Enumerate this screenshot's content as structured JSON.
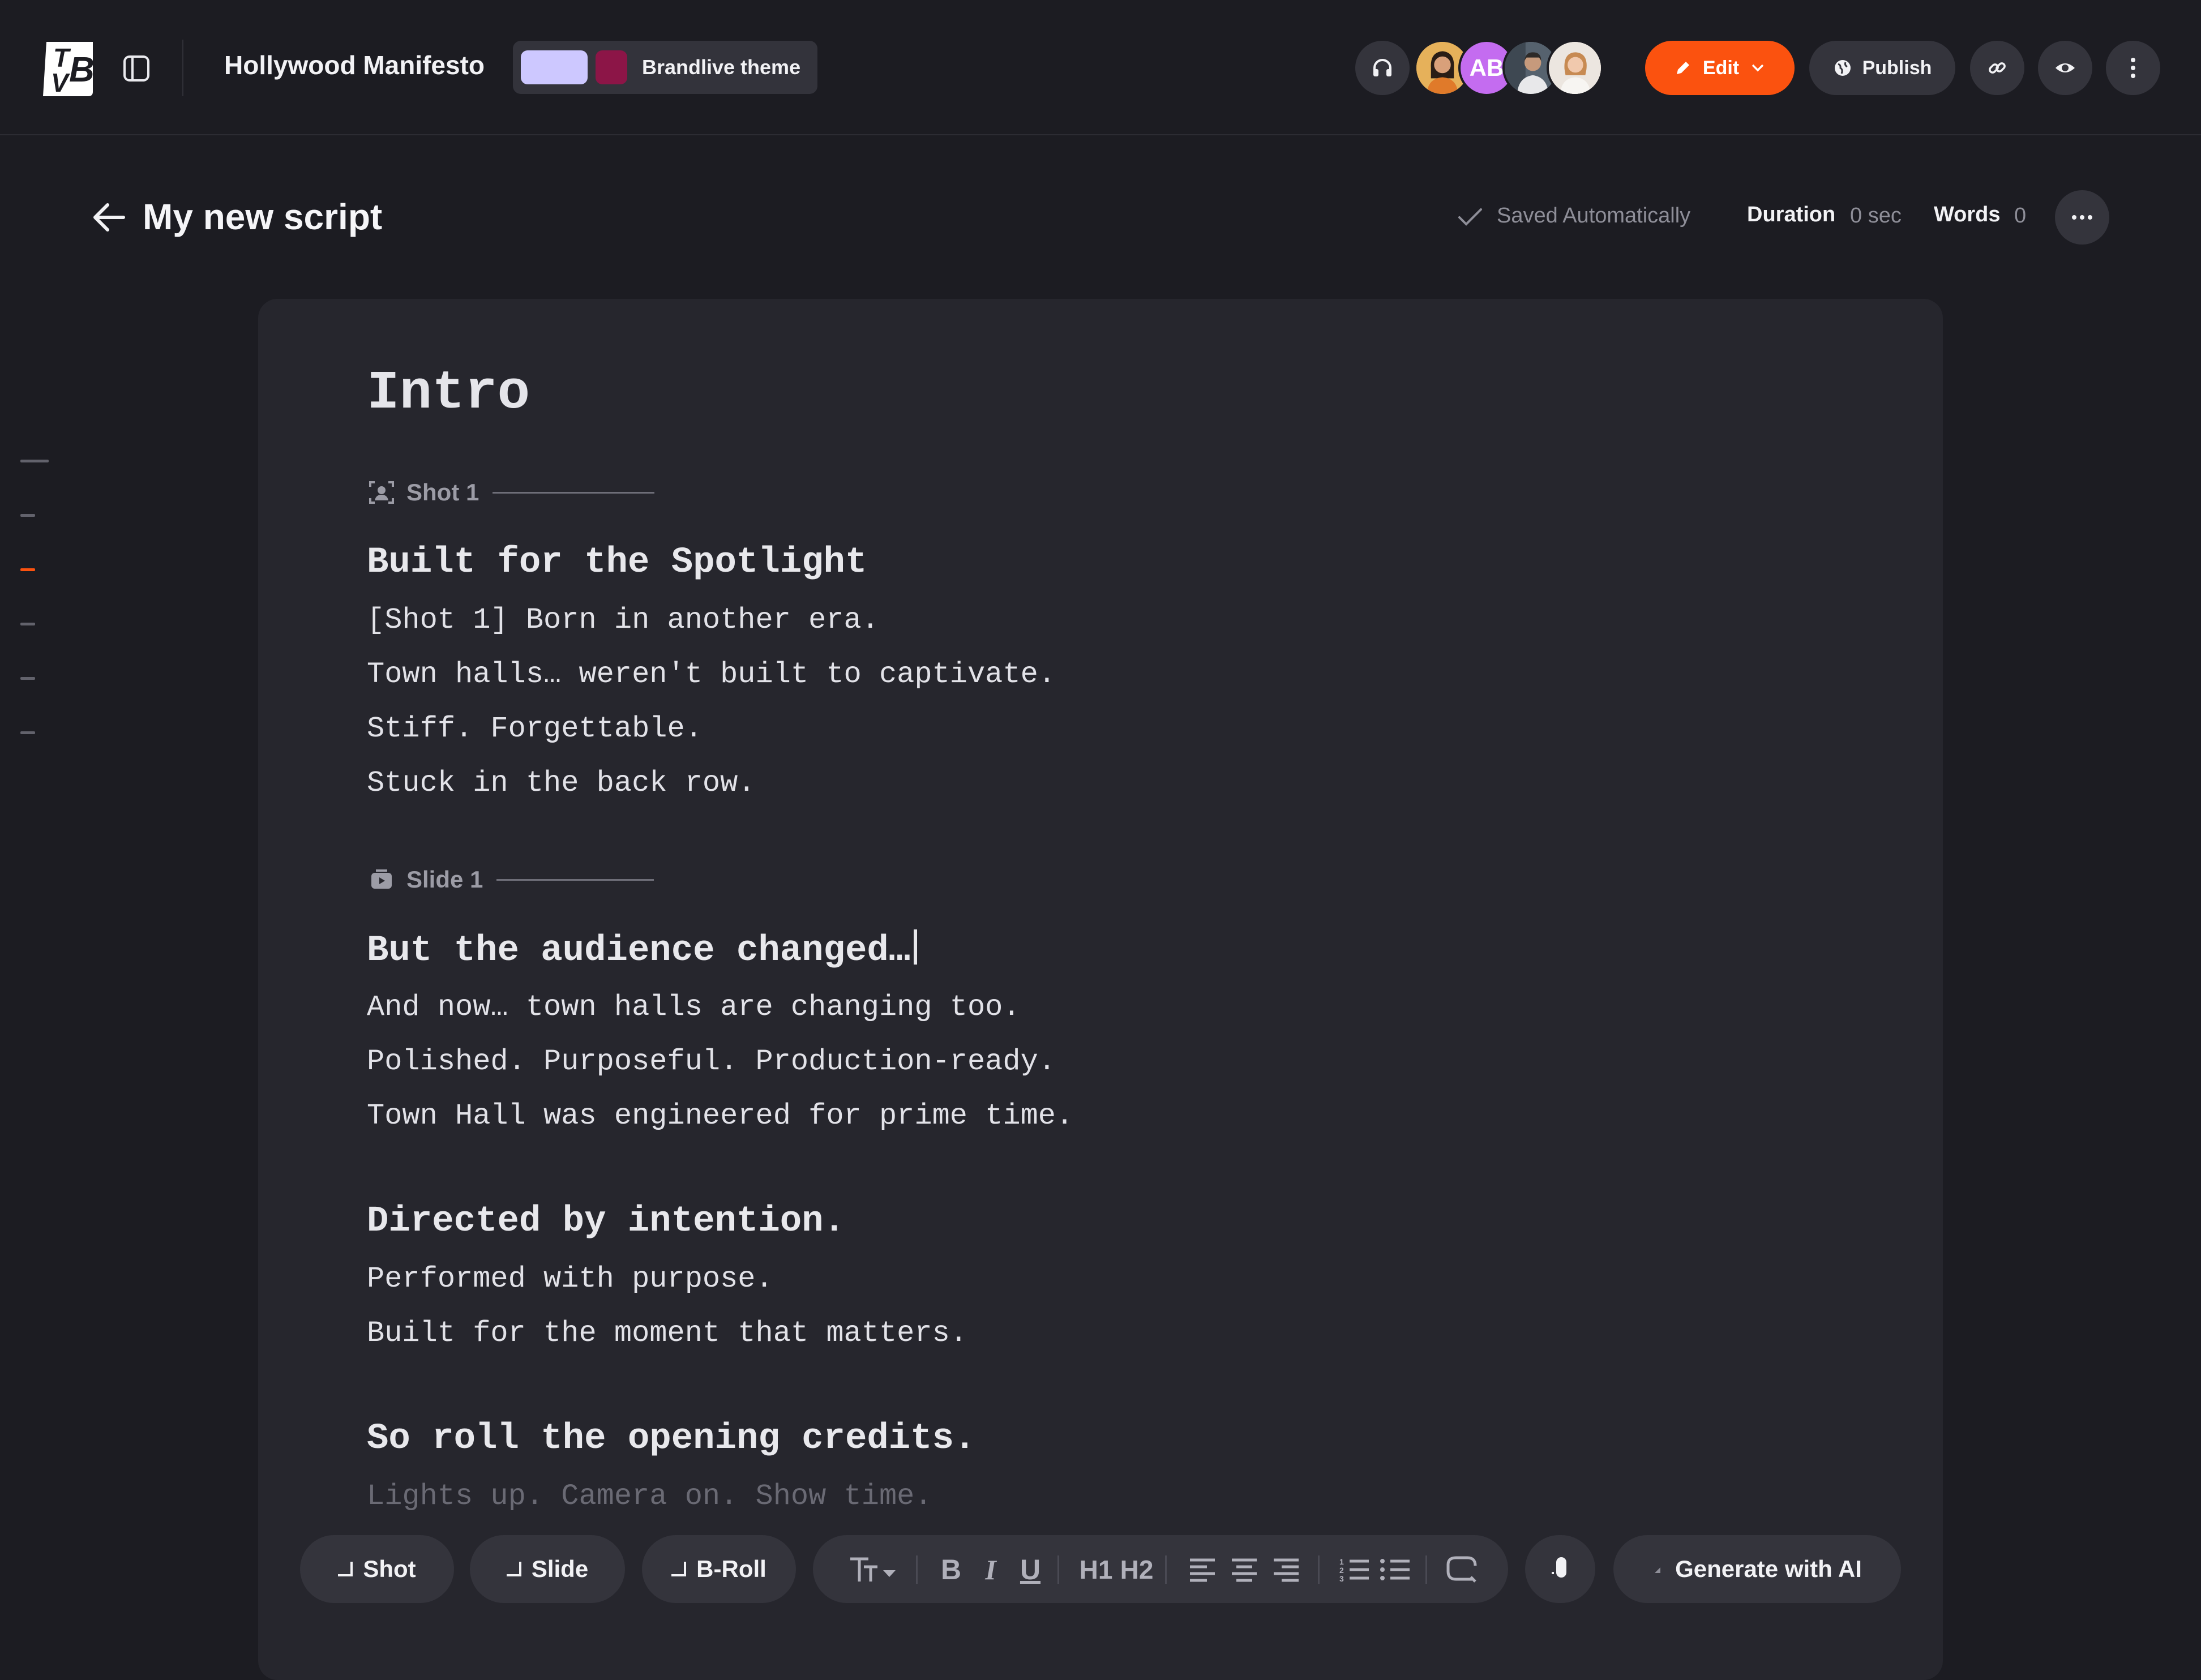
{
  "topbar": {
    "logo_letters": "TVB",
    "project_title": "Hollywood Manifesto",
    "theme": {
      "label": "Brandlive theme",
      "swatch_colors": [
        "#cdc8ff",
        "#8c1547"
      ]
    },
    "avatars": [
      {
        "icon": "person-avatar",
        "color": "#e0a94a"
      },
      {
        "initials": "AB",
        "color": "#c46cf0"
      },
      {
        "icon": "person-avatar",
        "color": "#6c7a88"
      },
      {
        "icon": "person-avatar",
        "color": "#d9c8b8"
      }
    ],
    "edit_label": "Edit",
    "publish_label": "Publish",
    "accent_color": "#fb520f"
  },
  "header": {
    "title": "My new script",
    "saved_status": "Saved Automatically",
    "duration_label": "Duration",
    "duration_value": "0 sec",
    "words_label": "Words",
    "words_value": "0"
  },
  "minimap": {
    "active_index": 2,
    "count": 6
  },
  "editor": {
    "section_title": "Intro",
    "shot_marker": "Shot 1",
    "slide_marker": "Slide 1",
    "block1": {
      "heading": "Built for the Spotlight",
      "lines": [
        "[Shot 1] Born in another era.",
        "Town halls… weren't built to captivate.",
        "Stiff. Forgettable.",
        "Stuck in the back row."
      ]
    },
    "block2": {
      "heading": "But the audience changed…",
      "lines": [
        "And now… town halls are changing too.",
        "Polished. Purposeful. Production-ready.",
        "Town Hall was engineered for prime time."
      ]
    },
    "block3": {
      "heading": "Directed by intention.",
      "lines": [
        "Performed with purpose.",
        "Built for the moment that matters."
      ]
    },
    "block4": {
      "heading": "So roll the opening credits.",
      "lines": [
        "Lights up. Camera on. Show time."
      ]
    }
  },
  "toolbar": {
    "shot_label": "Shot",
    "slide_label": "Slide",
    "broll_label": "B-Roll",
    "generate_label": "Generate with AI",
    "h1_label": "H1",
    "h2_label": "H2",
    "bold_label": "B",
    "italic_label": "I",
    "underline_label": "U"
  }
}
